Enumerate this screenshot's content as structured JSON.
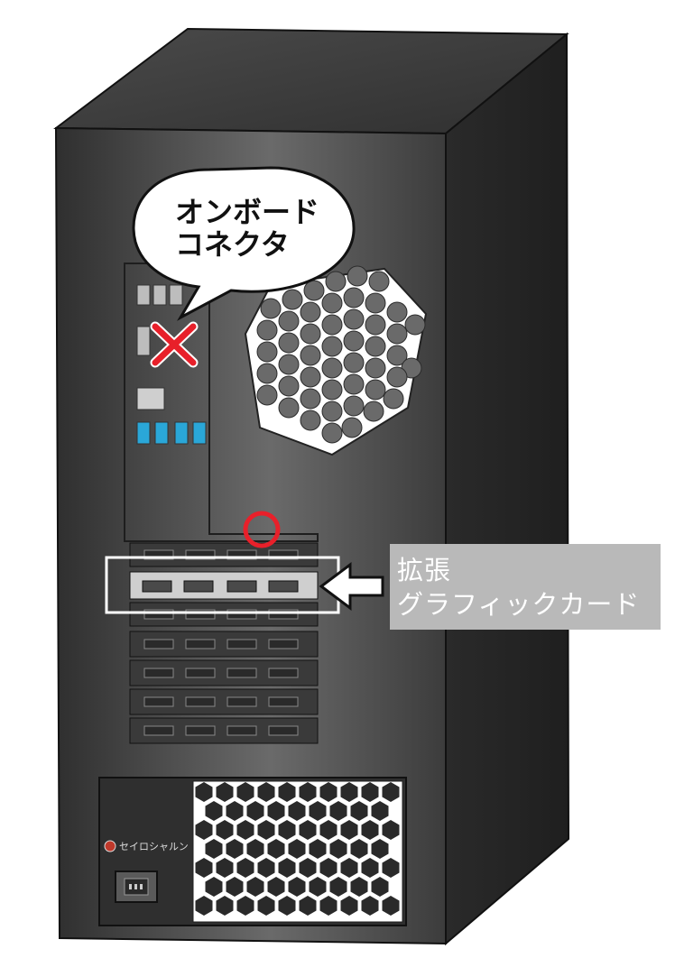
{
  "speech_bubble": {
    "line1": "オンボード",
    "line2": "コネクタ"
  },
  "callout": {
    "line1": "拡張",
    "line2": "グラフィックカード"
  },
  "brand": {
    "name": "セイロシャルン"
  },
  "marks": {
    "onboard_status": "✕",
    "expansion_status": "○",
    "cross_color": "#e8202a",
    "circle_color": "#e8202a"
  },
  "icons": [
    "speech-bubble",
    "cross-mark-icon",
    "circle-mark-icon",
    "arrow-left-icon",
    "brand-logo-icon",
    "power-socket-icon"
  ]
}
